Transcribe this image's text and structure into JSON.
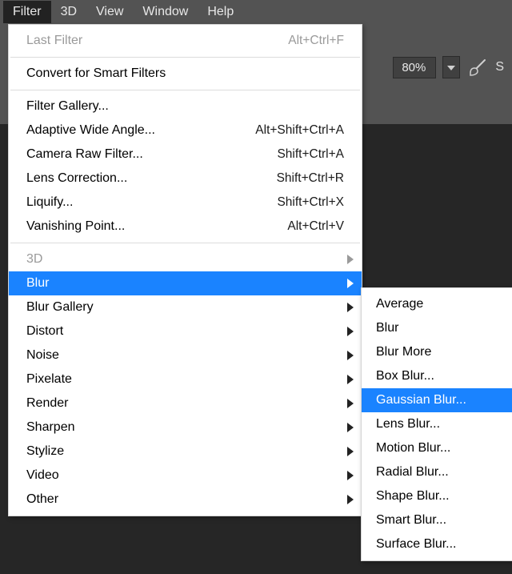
{
  "menubar": {
    "filter": "Filter",
    "threeD": "3D",
    "view": "View",
    "window": "Window",
    "help": "Help"
  },
  "toolbar": {
    "zoom": "80%",
    "trailing": "S"
  },
  "filterMenu": {
    "lastFilter": "Last Filter",
    "lastFilter_sc": "Alt+Ctrl+F",
    "convert": "Convert for Smart Filters",
    "filterGallery": "Filter Gallery...",
    "adaptive": "Adaptive Wide Angle...",
    "adaptive_sc": "Alt+Shift+Ctrl+A",
    "cameraRaw": "Camera Raw Filter...",
    "cameraRaw_sc": "Shift+Ctrl+A",
    "lens": "Lens Correction...",
    "lens_sc": "Shift+Ctrl+R",
    "liquify": "Liquify...",
    "liquify_sc": "Shift+Ctrl+X",
    "vanishing": "Vanishing Point...",
    "vanishing_sc": "Alt+Ctrl+V",
    "threeD": "3D",
    "blur": "Blur",
    "blurGallery": "Blur Gallery",
    "distort": "Distort",
    "noise": "Noise",
    "pixelate": "Pixelate",
    "render": "Render",
    "sharpen": "Sharpen",
    "stylize": "Stylize",
    "video": "Video",
    "other": "Other"
  },
  "blurSubmenu": {
    "average": "Average",
    "blur": "Blur",
    "blurMore": "Blur More",
    "boxBlur": "Box Blur...",
    "gaussian": "Gaussian Blur...",
    "lensBlur": "Lens Blur...",
    "motionBlur": "Motion Blur...",
    "radialBlur": "Radial Blur...",
    "shapeBlur": "Shape Blur...",
    "smartBlur": "Smart Blur...",
    "surfaceBlur": "Surface Blur..."
  }
}
